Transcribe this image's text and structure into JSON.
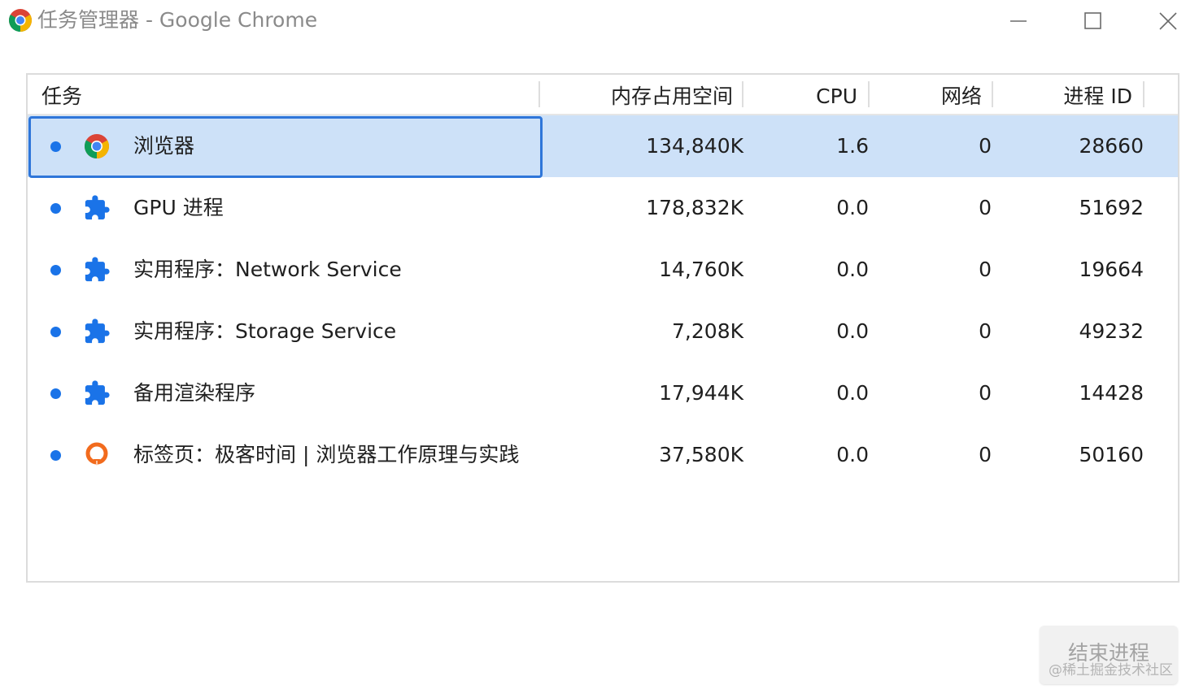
{
  "window": {
    "title": "任务管理器 - Google Chrome",
    "app_icon": "chrome-icon",
    "controls": {
      "minimize_icon": "minimize-icon",
      "maximize_icon": "maximize-icon",
      "close_icon": "close-icon"
    }
  },
  "table": {
    "columns": {
      "task": "任务",
      "memory": "内存占用空间",
      "cpu": "CPU",
      "network": "网络",
      "pid": "进程 ID"
    },
    "rows": [
      {
        "name": "浏览器",
        "icon": "chrome-icon",
        "memory": "134,840K",
        "cpu": "1.6",
        "network": "0",
        "pid": "28660",
        "selected": true
      },
      {
        "name": "GPU 进程",
        "icon": "extension-puzzle-icon",
        "memory": "178,832K",
        "cpu": "0.0",
        "network": "0",
        "pid": "51692",
        "selected": false
      },
      {
        "name": "实用程序：Network Service",
        "icon": "extension-puzzle-icon",
        "memory": "14,760K",
        "cpu": "0.0",
        "network": "0",
        "pid": "19664",
        "selected": false
      },
      {
        "name": "实用程序：Storage Service",
        "icon": "extension-puzzle-icon",
        "memory": "7,208K",
        "cpu": "0.0",
        "network": "0",
        "pid": "49232",
        "selected": false
      },
      {
        "name": "备用渲染程序",
        "icon": "extension-puzzle-icon",
        "memory": "17,944K",
        "cpu": "0.0",
        "network": "0",
        "pid": "14428",
        "selected": false
      },
      {
        "name": "标签页：极客时间 | 浏览器工作原理与实践",
        "icon": "geektime-favicon-icon",
        "memory": "37,580K",
        "cpu": "0.0",
        "network": "0",
        "pid": "50160",
        "selected": false
      }
    ]
  },
  "footer": {
    "end_process_label": "结束进程",
    "watermark": "@稀土掘金技术社区"
  },
  "colors": {
    "selection_bg": "#cde1f8",
    "selection_border": "#2f76d9",
    "status_dot": "#1a73e8",
    "puzzle_icon": "#1a73e8",
    "geektime_orange": "#f26b1d",
    "title_text": "#8a8a8a"
  }
}
